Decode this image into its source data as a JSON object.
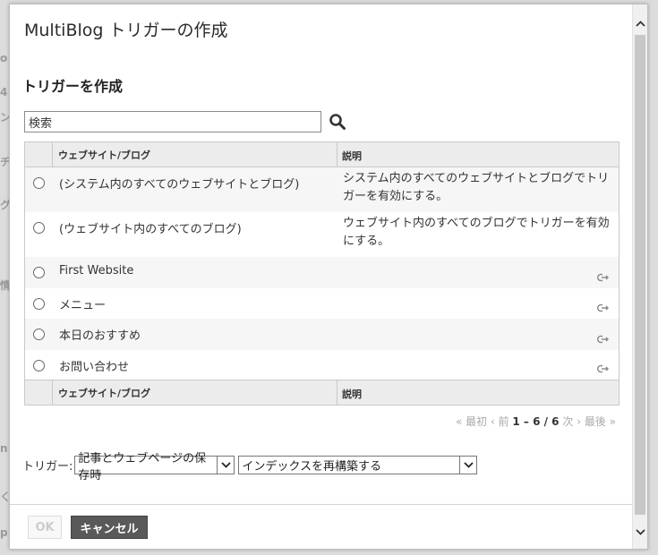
{
  "background": {
    "fragments": [
      "o",
      "4",
      "ン",
      "チ",
      "グ",
      "情",
      "n",
      "く",
      "p"
    ]
  },
  "dialog": {
    "title": "MultiBlog トリガーの作成",
    "section_title": "トリガーを作成",
    "search": {
      "value": "検索",
      "icon": "search-icon"
    },
    "table": {
      "columns": [
        "ウェブサイト/ブログ",
        "説明"
      ],
      "rows": [
        {
          "name": "(システム内のすべてのウェブサイトとブログ)",
          "description": "システム内のすべてのウェブサイトとブログでトリガーを有効にする。",
          "link": false
        },
        {
          "name": "(ウェブサイト内のすべてのブログ)",
          "description": "ウェブサイト内のすべてのブログでトリガーを有効にする。",
          "link": false
        },
        {
          "name": "First Website",
          "description": "",
          "link": true
        },
        {
          "name": "メニュー",
          "description": "",
          "link": true
        },
        {
          "name": "本日のおすすめ",
          "description": "",
          "link": true
        },
        {
          "name": "お問い合わせ",
          "description": "",
          "link": true
        }
      ]
    },
    "pager": {
      "first": "« 最初",
      "prev": "‹ 前",
      "range": "1 – 6 / 6",
      "next": "次 ›",
      "last": "最後 »"
    },
    "trigger": {
      "label": "トリガー:",
      "event_selected": "記事とウェブページの保存時",
      "action_selected": "インデックスを再構築する"
    },
    "buttons": {
      "ok": "OK",
      "cancel": "キャンセル"
    }
  }
}
